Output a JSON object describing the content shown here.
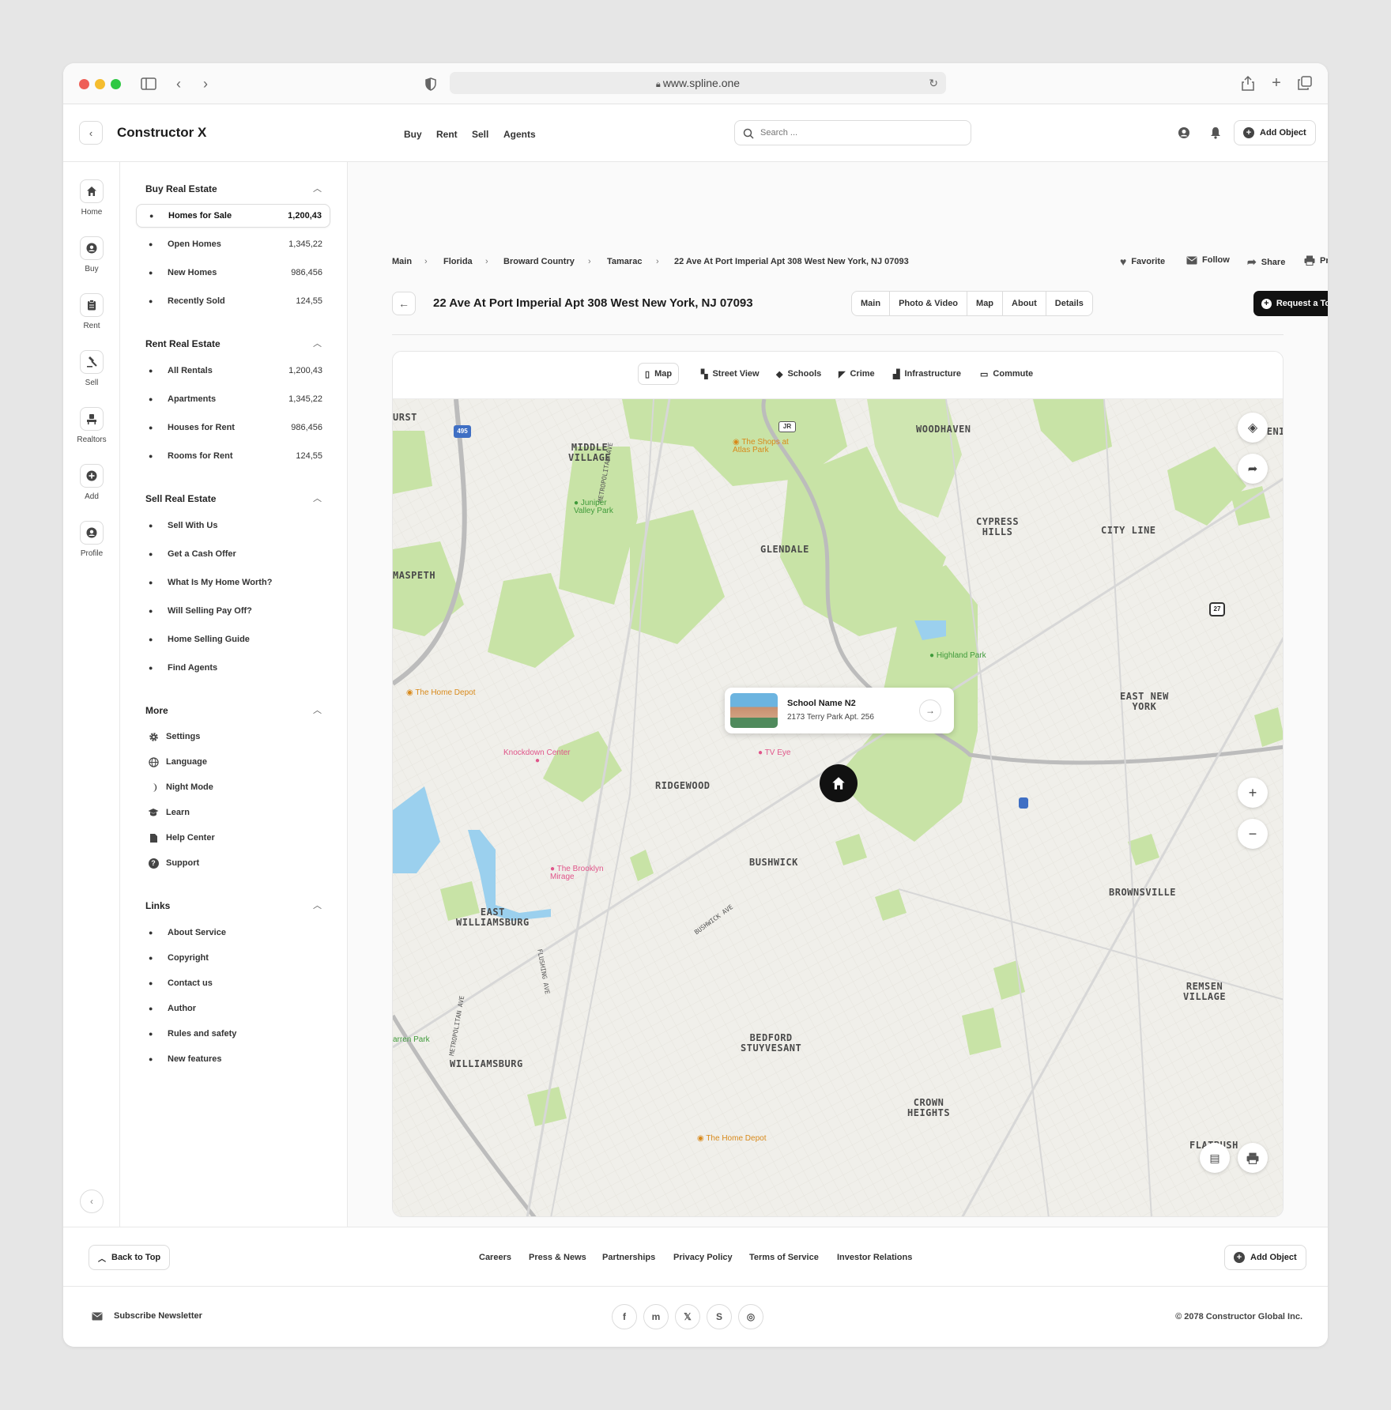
{
  "browser": {
    "url": "www.spline.one"
  },
  "header": {
    "brand": "Constructor X",
    "nav": [
      "Buy",
      "Rent",
      "Sell",
      "Agents"
    ],
    "search_placeholder": "Search ...",
    "add_object": "Add Object"
  },
  "rail": [
    {
      "label": "Home",
      "icon": "home-icon"
    },
    {
      "label": "Buy",
      "icon": "buy-icon"
    },
    {
      "label": "Rent",
      "icon": "rent-icon"
    },
    {
      "label": "Sell",
      "icon": "sell-icon"
    },
    {
      "label": "Realtors",
      "icon": "realtors-icon"
    },
    {
      "label": "Add",
      "icon": "add-icon"
    },
    {
      "label": "Profile",
      "icon": "profile-icon"
    }
  ],
  "sidebar": {
    "buy": {
      "title": "Buy Real Estate",
      "items": [
        {
          "label": "Homes for Sale",
          "count": "1,200,43",
          "active": true
        },
        {
          "label": "Open Homes",
          "count": "1,345,22"
        },
        {
          "label": "New Homes",
          "count": "986,456"
        },
        {
          "label": "Recently Sold",
          "count": "124,55"
        }
      ]
    },
    "rent": {
      "title": "Rent Real Estate",
      "items": [
        {
          "label": "All Rentals",
          "count": "1,200,43"
        },
        {
          "label": "Apartments",
          "count": "1,345,22"
        },
        {
          "label": "Houses for Rent",
          "count": "986,456"
        },
        {
          "label": "Rooms for Rent",
          "count": "124,55"
        }
      ]
    },
    "sell": {
      "title": "Sell Real Estate",
      "items": [
        {
          "label": "Sell With Us"
        },
        {
          "label": "Get a Cash Offer"
        },
        {
          "label": "What Is My Home Worth?"
        },
        {
          "label": "Will Selling Pay Off?"
        },
        {
          "label": "Home Selling Guide"
        },
        {
          "label": "Find Agents"
        }
      ]
    },
    "more": {
      "title": "More",
      "items": [
        {
          "label": "Settings",
          "icon": "gear-icon"
        },
        {
          "label": "Language",
          "icon": "globe-icon"
        },
        {
          "label": "Night Mode",
          "icon": "moon-icon"
        },
        {
          "label": "Learn",
          "icon": "graduation-cap-icon"
        },
        {
          "label": "Help Center",
          "icon": "document-icon"
        },
        {
          "label": "Support",
          "icon": "question-icon"
        }
      ]
    },
    "links": {
      "title": "Links",
      "items": [
        {
          "label": "About Service"
        },
        {
          "label": "Copyright"
        },
        {
          "label": "Contact us"
        },
        {
          "label": "Author"
        },
        {
          "label": "Rules and safety"
        },
        {
          "label": "New features"
        }
      ]
    }
  },
  "breadcrumb": [
    "Main",
    "Florida",
    "Broward Country",
    "Tamarac",
    "22 Ave At Port Imperial Apt 308 West New York, NJ 07093"
  ],
  "actions": {
    "favorite": "Favorite",
    "follow": "Follow",
    "share": "Share",
    "print": "Print"
  },
  "listing": {
    "title": "22 Ave At Port Imperial Apt 308 West New York, NJ 07093",
    "tabs": [
      "Main",
      "Photo & Video",
      "Map",
      "About",
      "Details"
    ],
    "request_tour": "Request a Tour"
  },
  "map": {
    "tabs": [
      "Map",
      "Street View",
      "Schools",
      "Crime",
      "Infrastructure",
      "Commute"
    ],
    "selected_tab": "Map",
    "labels": {
      "urst": "URST",
      "middle_village": "MIDDLE\nVILLAGE",
      "woodhaven": "WOODHAVEN",
      "deni": "DENI",
      "cypress_hills": "CYPRESS\nHILLS",
      "city_line": "CITY LINE",
      "glendale": "GLENDALE",
      "maspeth": "MASPETH",
      "east_new_york": "EAST NEW\nYORK",
      "ridgewood": "RIDGEWOOD",
      "bushwick": "BUSHWICK",
      "brownsville": "BROWNSVILLE",
      "east_williamsburg": "EAST\nWILLIAMSBURG",
      "remsen_village": "REMSEN\nVILLAGE",
      "williamsburg": "WILLIAMSBURG",
      "bedford_stuyvesant": "BEDFORD\nSTUYVESANT",
      "crown_heights": "CROWN\nHEIGHTS",
      "flatbush": "FLATBUSH"
    },
    "streets": {
      "metropolitan_1": "METROPOLITAN AVE",
      "metropolitan_2": "METROPOLITAN AVE",
      "flushing": "FLUSHING AVE",
      "bushwick_ave": "BUSHWICK AVE"
    },
    "shields": {
      "i495": "495",
      "jr": "JR",
      "r27": "27"
    },
    "pois": {
      "shops": "The Shops at\nAtlas Park",
      "juniper": "Juniper\nValley Park",
      "highland": "Highland Park",
      "home_depot_1": "The Home Depot",
      "knockdown": "Knockdown Center",
      "tv_eye": "TV Eye",
      "brooklyn_mirage": "The Brooklyn\nMirage",
      "arren": "arren Park",
      "home_depot_2": "The Home Depot"
    },
    "popup": {
      "name": "School Name N2",
      "address": "2173 Terry Park Apt. 256"
    }
  },
  "footer": {
    "back_to_top": "Back to Top",
    "links": [
      "Careers",
      "Press & News",
      "Partnerships",
      "Privacy Policy",
      "Terms of Service",
      "Investor Relations"
    ],
    "add_object": "Add Object",
    "newsletter": "Subscribe Newsletter",
    "social": [
      {
        "icon": "facebook-icon",
        "glyph": "f"
      },
      {
        "icon": "messenger-icon",
        "glyph": "m"
      },
      {
        "icon": "x-icon",
        "glyph": "𝕏"
      },
      {
        "icon": "skype-icon",
        "glyph": "S"
      },
      {
        "icon": "instagram-icon",
        "glyph": "◎"
      }
    ],
    "copyright": "© 2078 Constructor Global Inc."
  }
}
